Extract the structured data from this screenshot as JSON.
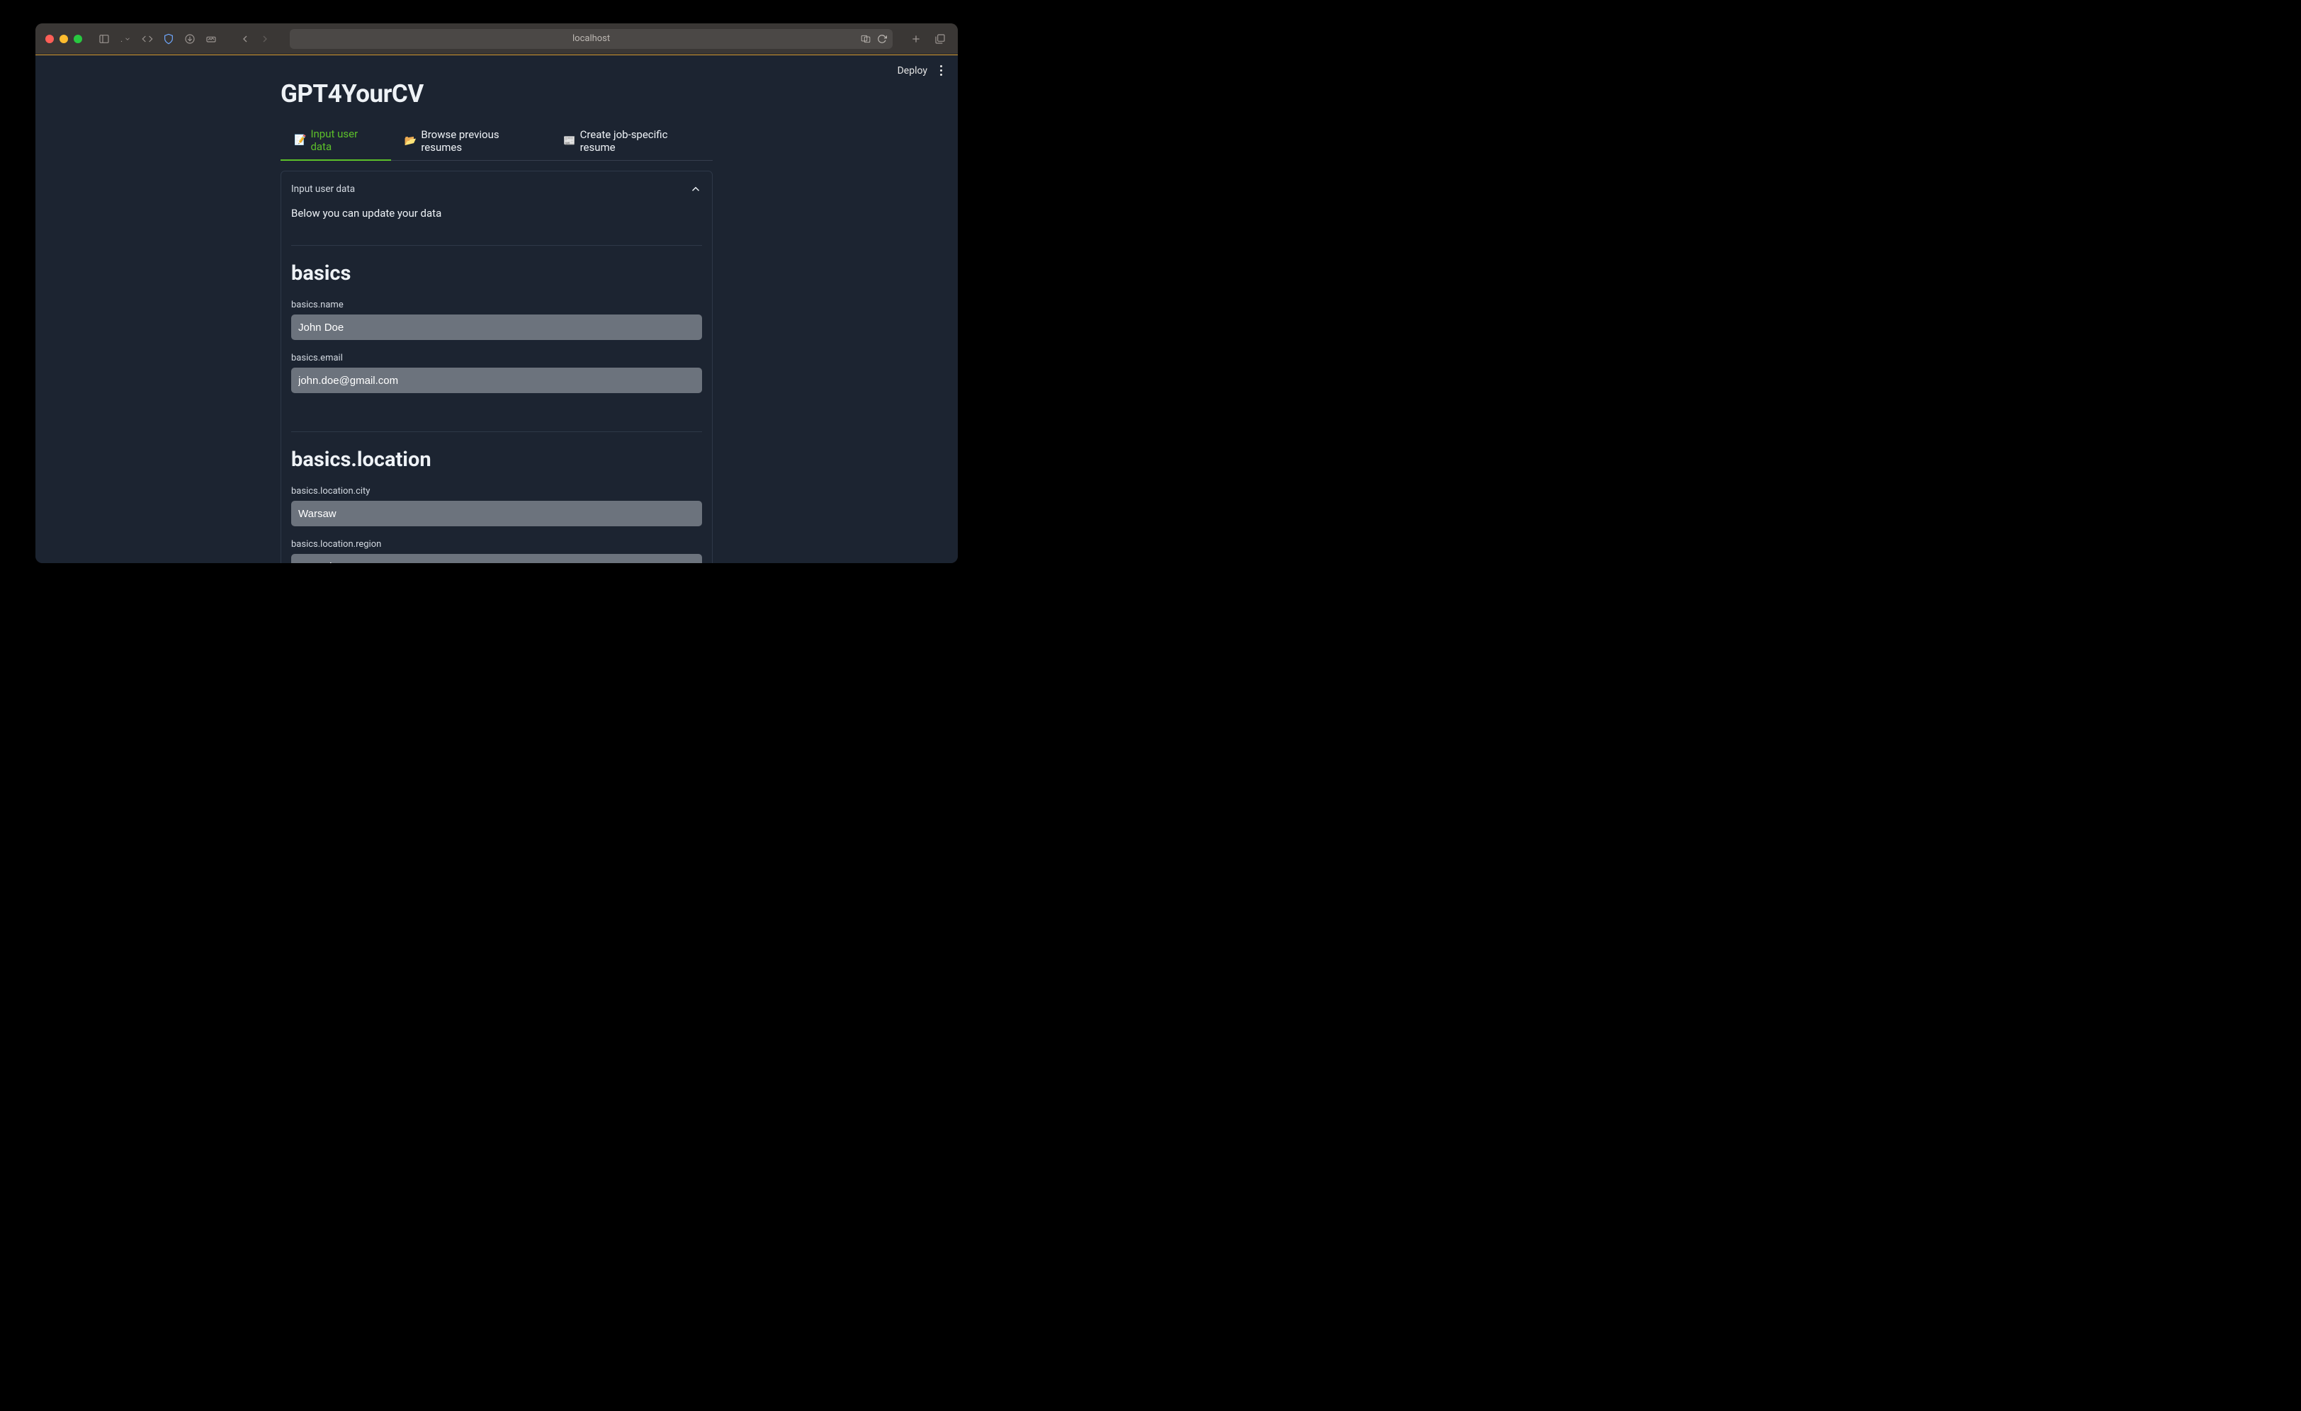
{
  "browser": {
    "address": "localhost"
  },
  "topbar": {
    "deploy": "Deploy"
  },
  "app": {
    "title": "GPT4YourCV"
  },
  "tabs": [
    {
      "emoji": "📝",
      "label": "Input user data",
      "active": true
    },
    {
      "emoji": "📂",
      "label": "Browse previous resumes",
      "active": false
    },
    {
      "emoji": "📰",
      "label": "Create job-specific resume",
      "active": false
    }
  ],
  "panel": {
    "header": "Input user data",
    "sub": "Below you can update your data"
  },
  "sections": {
    "basics": {
      "heading": "basics",
      "name_label": "basics.name",
      "name_value": "John Doe",
      "email_label": "basics.email",
      "email_value": "john.doe@gmail.com"
    },
    "location": {
      "heading": "basics.location",
      "city_label": "basics.location.city",
      "city_value": "Warsaw",
      "region_label": "basics.location.region",
      "region_value": "Mazovia"
    }
  },
  "colors": {
    "accent_green": "#5cbf2a",
    "bg_app": "#1c2431",
    "input_bg": "#6c737d"
  }
}
